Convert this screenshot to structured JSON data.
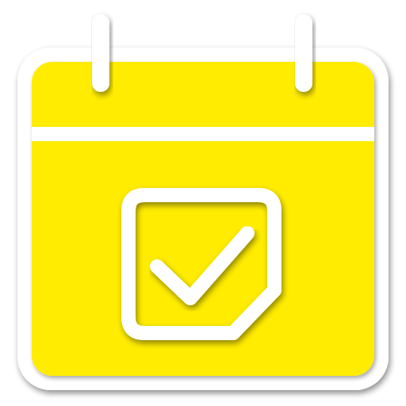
{
  "icon": {
    "name": "calendar-check-icon",
    "fill_color": "#FFEC00",
    "stroke_color": "#FFFFFF",
    "background_color": "#FFFFFF",
    "shadow_color": "#000000"
  }
}
